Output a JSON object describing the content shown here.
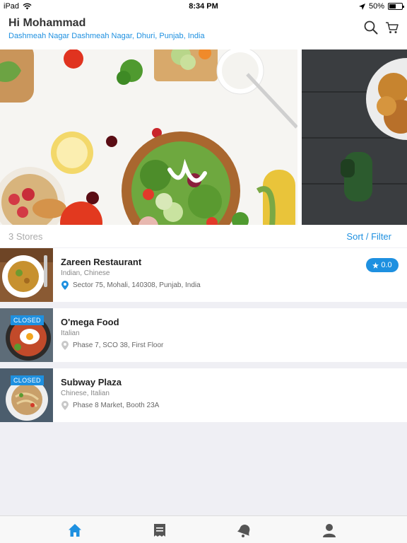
{
  "status_bar": {
    "device": "iPad",
    "time": "8:34 PM",
    "battery": "50%",
    "battery_level": 0.5
  },
  "header": {
    "greeting": "Hi Mohammad",
    "location": "Dashmeah Nagar Dashmeah Nagar, Dhuri, Punjab, India"
  },
  "stores_bar": {
    "count_label": "3 Stores",
    "sort_label": "Sort / Filter"
  },
  "stores": [
    {
      "name": "Zareen Restaurant",
      "cuisine": "Indian, Chinese",
      "address": "Sector 75, Mohali, 140308, Punjab, India",
      "rating": "0.0",
      "closed": false
    },
    {
      "name": "O'mega Food",
      "cuisine": "Italian",
      "address": "Phase 7, SCO 38, First Floor",
      "closed": true,
      "badge": "CLOSED"
    },
    {
      "name": "Subway Plaza",
      "cuisine": "Chinese, Italian",
      "address": "Phase 8 Market, Booth 23A",
      "closed": true,
      "badge": "CLOSED"
    }
  ],
  "colors": {
    "accent": "#1e90e0",
    "background": "#efeff4",
    "inactive_icon": "#555555"
  },
  "tabs": [
    {
      "icon": "home-icon",
      "active": true
    },
    {
      "icon": "orders-icon",
      "active": false
    },
    {
      "icon": "notifications-icon",
      "active": false
    },
    {
      "icon": "profile-icon",
      "active": false
    }
  ]
}
